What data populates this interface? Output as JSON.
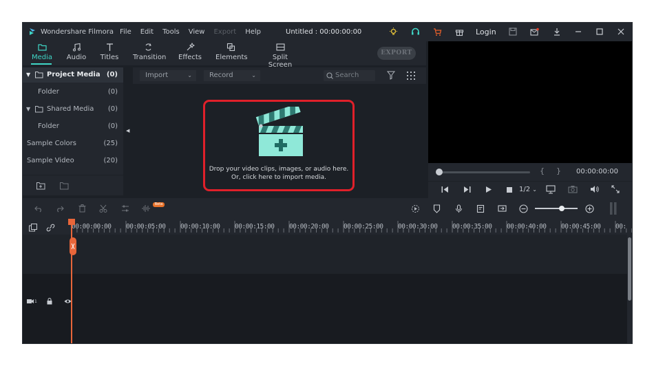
{
  "app": {
    "name": "Wondershare Filmora",
    "document_title": "Untitled : 00:00:00:00",
    "accent": "#3fd6c6",
    "highlight": "#e0202a"
  },
  "menu": [
    {
      "label": "File",
      "enabled": true
    },
    {
      "label": "Edit",
      "enabled": true
    },
    {
      "label": "Tools",
      "enabled": true
    },
    {
      "label": "View",
      "enabled": true
    },
    {
      "label": "Export",
      "enabled": false
    },
    {
      "label": "Help",
      "enabled": true
    }
  ],
  "titlebar_icons": [
    "lightbulb-icon",
    "headset-icon",
    "cart-icon",
    "gift-icon",
    "login-label",
    "save-icon",
    "mail-icon",
    "download-icon"
  ],
  "login_label": "Login",
  "tabs": [
    {
      "label": "Media",
      "icon": "folder-icon",
      "active": true
    },
    {
      "label": "Audio",
      "icon": "music-icon",
      "active": false
    },
    {
      "label": "Titles",
      "icon": "text-icon",
      "active": false
    },
    {
      "label": "Transition",
      "icon": "transition-icon",
      "active": false
    },
    {
      "label": "Effects",
      "icon": "effects-icon",
      "active": false
    },
    {
      "label": "Elements",
      "icon": "elements-icon",
      "active": false
    },
    {
      "label": "Split Screen",
      "icon": "split-screen-icon",
      "active": false
    }
  ],
  "export_label": "EXPORT",
  "sidebar": {
    "items": [
      {
        "label": "Project Media",
        "count": "(0)",
        "expandable": true,
        "selected": true
      },
      {
        "label": "Folder",
        "count": "(0)",
        "expandable": false,
        "selected": false
      },
      {
        "label": "Shared Media",
        "count": "(0)",
        "expandable": true,
        "selected": false
      },
      {
        "label": "Folder",
        "count": "(0)",
        "expandable": false,
        "selected": false
      },
      {
        "label": "Sample Colors",
        "count": "(25)",
        "expandable": false,
        "selected": false
      },
      {
        "label": "Sample Video",
        "count": "(20)",
        "expandable": false,
        "selected": false
      }
    ]
  },
  "media_toolbar": {
    "import_label": "Import",
    "record_label": "Record",
    "search_placeholder": "Search"
  },
  "dropzone": {
    "line1": "Drop your video clips, images, or audio here.",
    "line2": "Or, click here to import media."
  },
  "preview": {
    "timecode": "00:00:00:00",
    "quality": "1/2",
    "brackets_left": "{",
    "brackets_right": "}"
  },
  "timeline": {
    "beta_badge": "Beta",
    "ruler_labels": [
      "00:00:00:00",
      "00:00:05:00",
      "00:00:10:00",
      "00:00:15:00",
      "00:00:20:00",
      "00:00:25:00",
      "00:00:30:00",
      "00:00:35:00",
      "00:00:40:00",
      "00:00:45:00",
      "00:"
    ],
    "track_label": "1"
  }
}
